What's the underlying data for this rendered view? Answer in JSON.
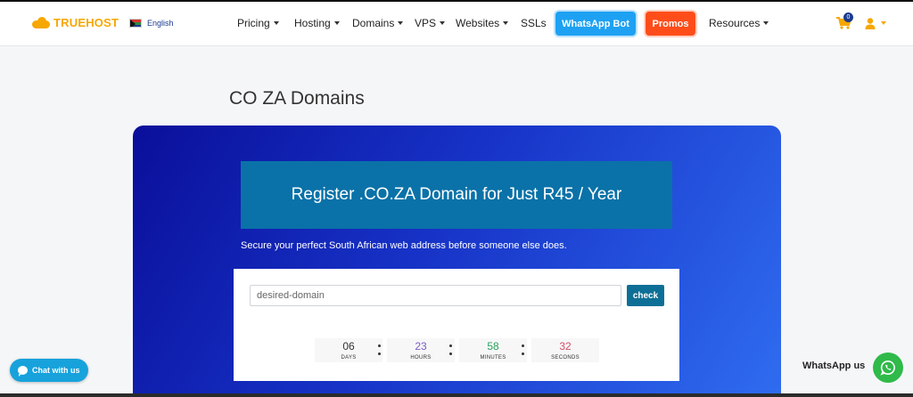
{
  "brand": {
    "name": "TRUEHOST",
    "color": "#f6a700"
  },
  "language": {
    "label": "English",
    "flag": "south-africa-flag"
  },
  "nav": {
    "items": [
      {
        "label": "Pricing",
        "dropdown": true
      },
      {
        "label": "Hosting",
        "dropdown": true
      },
      {
        "label": "Domains",
        "dropdown": true
      },
      {
        "label": "VPS",
        "dropdown": true
      },
      {
        "label": "Websites",
        "dropdown": true
      },
      {
        "label": "SSLs",
        "dropdown": false
      }
    ],
    "whatsapp_bot": "WhatsApp Bot",
    "promos": "Promos",
    "resources": "Resources"
  },
  "cart": {
    "count": "0"
  },
  "page": {
    "title": "CO ZA Domains"
  },
  "hero": {
    "banner": "Register .CO.ZA Domain for Just R45 / Year",
    "subtitle": "Secure your perfect South African web address before someone else does."
  },
  "search": {
    "placeholder": "desired-domain",
    "value": "",
    "button_label": "check"
  },
  "countdown": {
    "days": {
      "value": "06",
      "label": "DAYS",
      "color": "#333333"
    },
    "hours": {
      "value": "23",
      "label": "HOURS",
      "color": "#7a5cc4"
    },
    "minutes": {
      "value": "58",
      "label": "MINUTES",
      "color": "#2aa15a"
    },
    "seconds": {
      "value": "32",
      "label": "SECONDS",
      "color": "#d4506a"
    }
  },
  "chat": {
    "label": "Chat with us"
  },
  "whatsapp": {
    "label": "WhatsApp us"
  },
  "colors": {
    "hero_start": "#0a0f9a",
    "hero_end": "#2f6cf0",
    "banner": "#0a72a8",
    "accent_blue": "#1ea1f2",
    "promo_orange": "#ff4d1a",
    "check_button": "#0e6f96",
    "whatsapp_green": "#2fba4a"
  }
}
